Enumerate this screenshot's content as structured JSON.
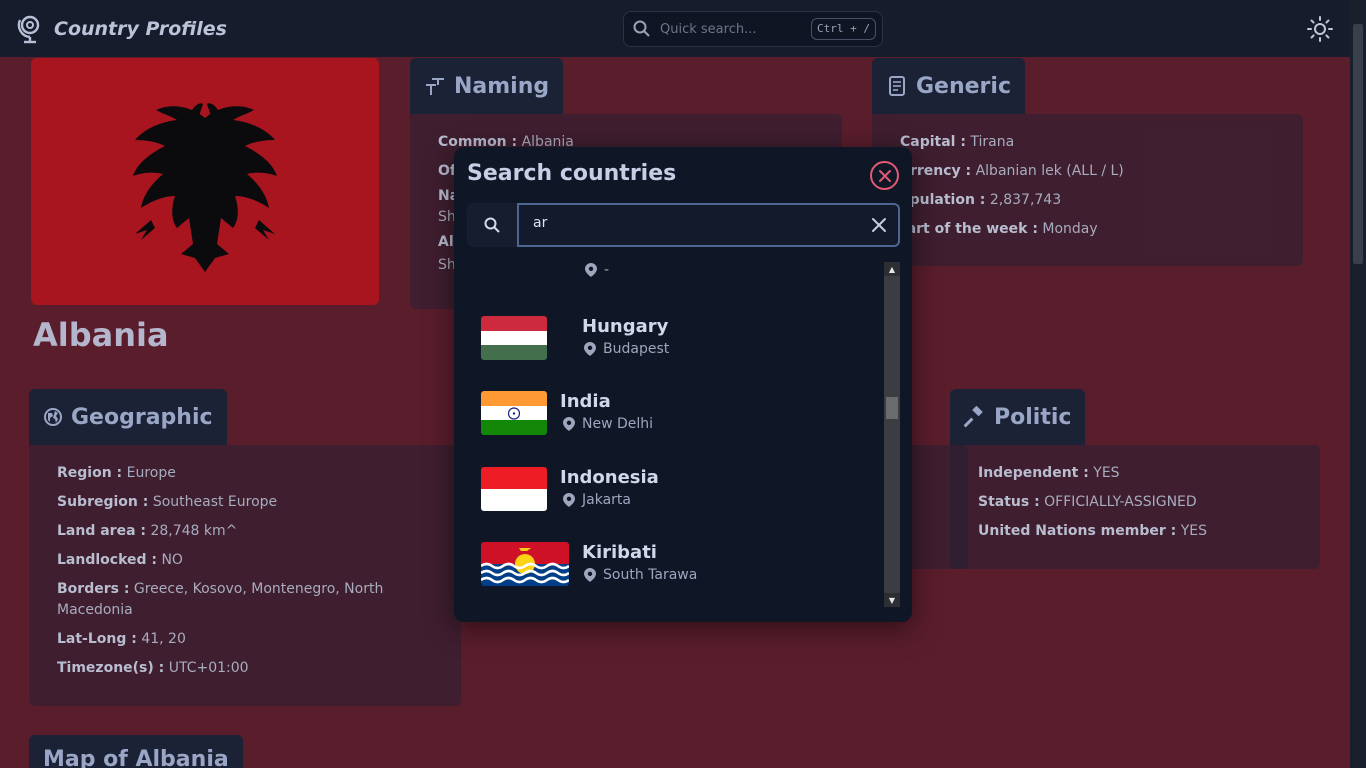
{
  "header": {
    "app_title": "Country Profiles",
    "quick_search_placeholder": "Quick search...",
    "quick_search_shortcut": "Ctrl + /"
  },
  "country": {
    "name": "Albania",
    "flag_colors": {
      "field": "#a9151f",
      "eagle": "#0b0b0d"
    }
  },
  "sections": {
    "naming": {
      "title": "Naming",
      "common_label": "Common :",
      "common_value": "Albania",
      "partial_1": "Of",
      "partial_2": "Na",
      "partial_3": "Sh",
      "partial_4": "Al",
      "partial_5": "Sh"
    },
    "generic": {
      "title": "Generic",
      "rows": [
        {
          "label": "Capital :",
          "value": "Tirana"
        },
        {
          "label": "urrency :",
          "value": "Albanian lek (ALL / L)"
        },
        {
          "label": "opulation :",
          "value": "2,837,743"
        },
        {
          "label": "tart of the week :",
          "value": "Monday"
        }
      ]
    },
    "geographic": {
      "title": "Geographic",
      "rows": [
        {
          "label": "Region :",
          "value": "Europe"
        },
        {
          "label": "Subregion :",
          "value": "Southeast Europe"
        },
        {
          "label": "Land area :",
          "value": "28,748 km^"
        },
        {
          "label": "Landlocked :",
          "value": "NO"
        },
        {
          "label": "Borders :",
          "value": "Greece, Kosovo, Montenegro, North Macedonia"
        },
        {
          "label": "Lat-Long :",
          "value": "41, 20"
        },
        {
          "label": "Timezone(s) :",
          "value": "UTC+01:00"
        }
      ]
    },
    "politic": {
      "title": "Politic",
      "rows": [
        {
          "label": "Independent :",
          "value": "YES"
        },
        {
          "label": "Status :",
          "value": "OFFICIALLY-ASSIGNED"
        },
        {
          "label": "United Nations member :",
          "value": "YES"
        }
      ]
    },
    "map": {
      "title": "Map of Albania"
    }
  },
  "modal": {
    "title": "Search countries",
    "query": "ar",
    "partial_capital": "-",
    "results": [
      {
        "name": "Hungary",
        "capital": "Budapest"
      },
      {
        "name": "India",
        "capital": "New Delhi"
      },
      {
        "name": "Indonesia",
        "capital": "Jakarta"
      },
      {
        "name": "Kiribati",
        "capital": "South Tarawa"
      }
    ]
  },
  "colors": {
    "accent_close": "#e25a73",
    "page_bg": "#5a1d2c",
    "header_bg": "#161c2c",
    "modal_bg": "#0f1626"
  }
}
